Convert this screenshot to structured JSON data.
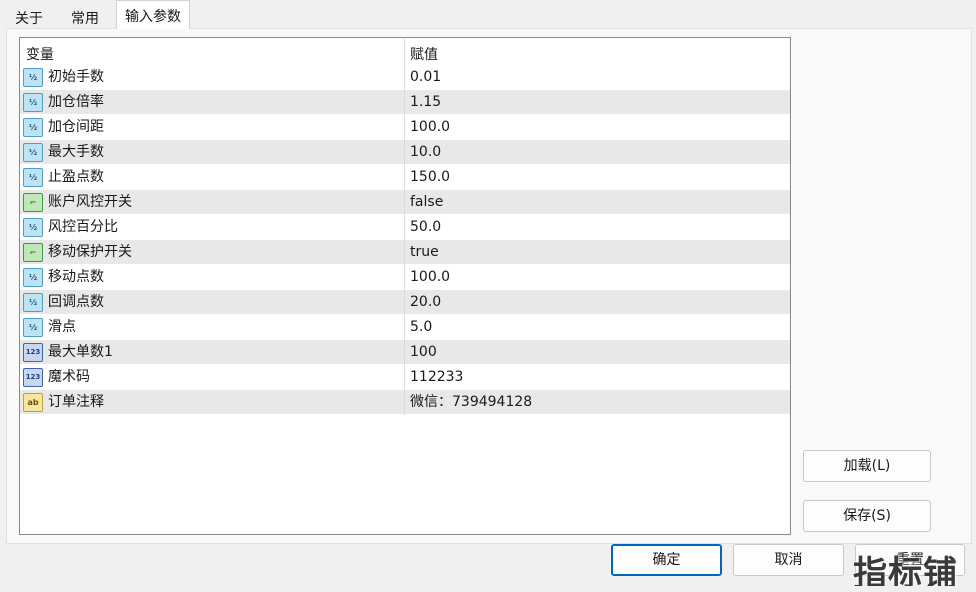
{
  "tabs": [
    {
      "label": "关于"
    },
    {
      "label": "常用"
    },
    {
      "label": "输入参数"
    }
  ],
  "grid": {
    "col_variable": "变量",
    "col_value": "赋值",
    "rows": [
      {
        "icon": "double-type-icon",
        "badge": "½",
        "name": "初始手数",
        "value": "0.01"
      },
      {
        "icon": "double-type-icon",
        "badge": "½",
        "name": "加仓倍率",
        "value": "1.15"
      },
      {
        "icon": "double-type-icon",
        "badge": "½",
        "name": "加仓间距",
        "value": "100.0"
      },
      {
        "icon": "double-type-icon",
        "badge": "½",
        "name": "最大手数",
        "value": "10.0"
      },
      {
        "icon": "double-type-icon",
        "badge": "½",
        "name": "止盈点数",
        "value": "150.0"
      },
      {
        "icon": "bool-type-icon",
        "badge": "⌐",
        "name": "账户风控开关",
        "value": "false"
      },
      {
        "icon": "double-type-icon",
        "badge": "½",
        "name": "风控百分比",
        "value": "50.0"
      },
      {
        "icon": "bool-type-icon",
        "badge": "⌐",
        "name": "移动保护开关",
        "value": "true"
      },
      {
        "icon": "double-type-icon",
        "badge": "½",
        "name": "移动点数",
        "value": "100.0"
      },
      {
        "icon": "double-type-icon",
        "badge": "½",
        "name": "回调点数",
        "value": "20.0"
      },
      {
        "icon": "double-type-icon",
        "badge": "½",
        "name": "滑点",
        "value": "5.0"
      },
      {
        "icon": "int-type-icon",
        "badge": "123",
        "name": "最大单数1",
        "value": "100"
      },
      {
        "icon": "int-type-icon",
        "badge": "123",
        "name": "魔术码",
        "value": "112233"
      },
      {
        "icon": "string-type-icon",
        "badge": "ab",
        "name": "订单注释",
        "value": "微信：739494128"
      }
    ]
  },
  "buttons": {
    "load": "加载(L)",
    "save": "保存(S)",
    "ok": "确定",
    "cancel": "取消",
    "reset": "重置"
  },
  "watermark": "指标铺"
}
